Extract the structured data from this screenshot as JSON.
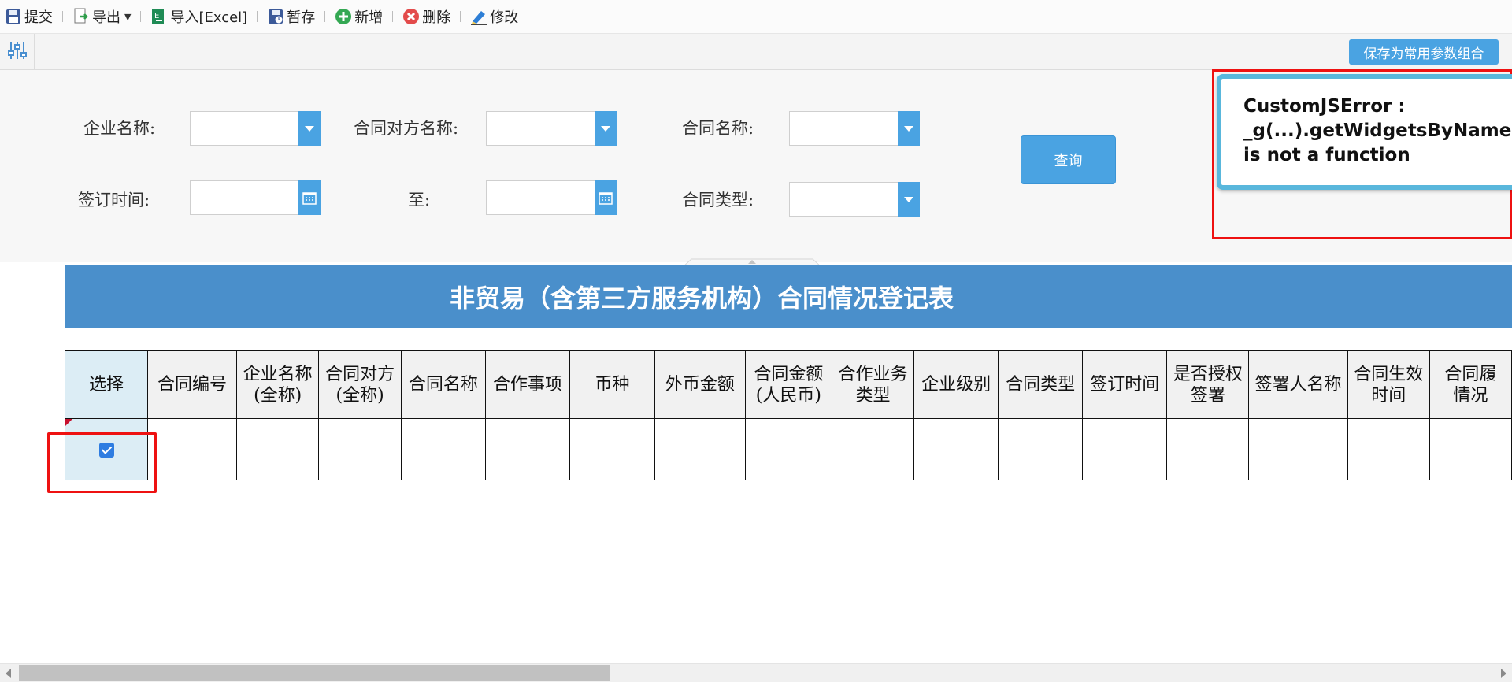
{
  "toolbar": {
    "buttons": [
      {
        "label": "提交",
        "icon": "save-icon"
      },
      {
        "label": "导出",
        "icon": "export-icon"
      },
      {
        "label": "导入[Excel]",
        "icon": "excel-import-icon"
      },
      {
        "label": "暂存",
        "icon": "temp-save-icon"
      },
      {
        "label": "新增",
        "icon": "add-icon"
      },
      {
        "label": "删除",
        "icon": "delete-icon"
      },
      {
        "label": "修改",
        "icon": "edit-icon"
      }
    ]
  },
  "param_bar": {
    "save_combo_label": "保存为常用参数组合"
  },
  "form": {
    "company_label": "企业名称:",
    "counterparty_label": "合同对方名称:",
    "contract_name_label": "合同名称:",
    "sign_time_label": "签订时间:",
    "to_label": "至:",
    "contract_type_label": "合同类型:",
    "query_label": "查询"
  },
  "error": {
    "message": "CustomJSError :\n_g(...).getWidgetsByName(...)\nis not a function"
  },
  "report": {
    "title": "非贸易（含第三方服务机构）合同情况登记表",
    "columns": [
      "选择",
      "合同编号",
      "企业名称\n(全称)",
      "合同对方\n(全称)",
      "合同名称",
      "合作事项",
      "币种",
      "外币金额",
      "合同金额\n(人民币)",
      "合作业务\n类型",
      "企业级别",
      "合同类型",
      "签订时间",
      "是否授权\n签署",
      "签署人名称",
      "合同生效\n时间",
      "合同履\n情况"
    ],
    "rows": [
      {
        "selected": true
      }
    ]
  },
  "colors": {
    "accent": "#4aa3e2",
    "banner": "#4a8fcb",
    "highlight_frame": "#ee1111",
    "error_border": "#59b7dc"
  }
}
